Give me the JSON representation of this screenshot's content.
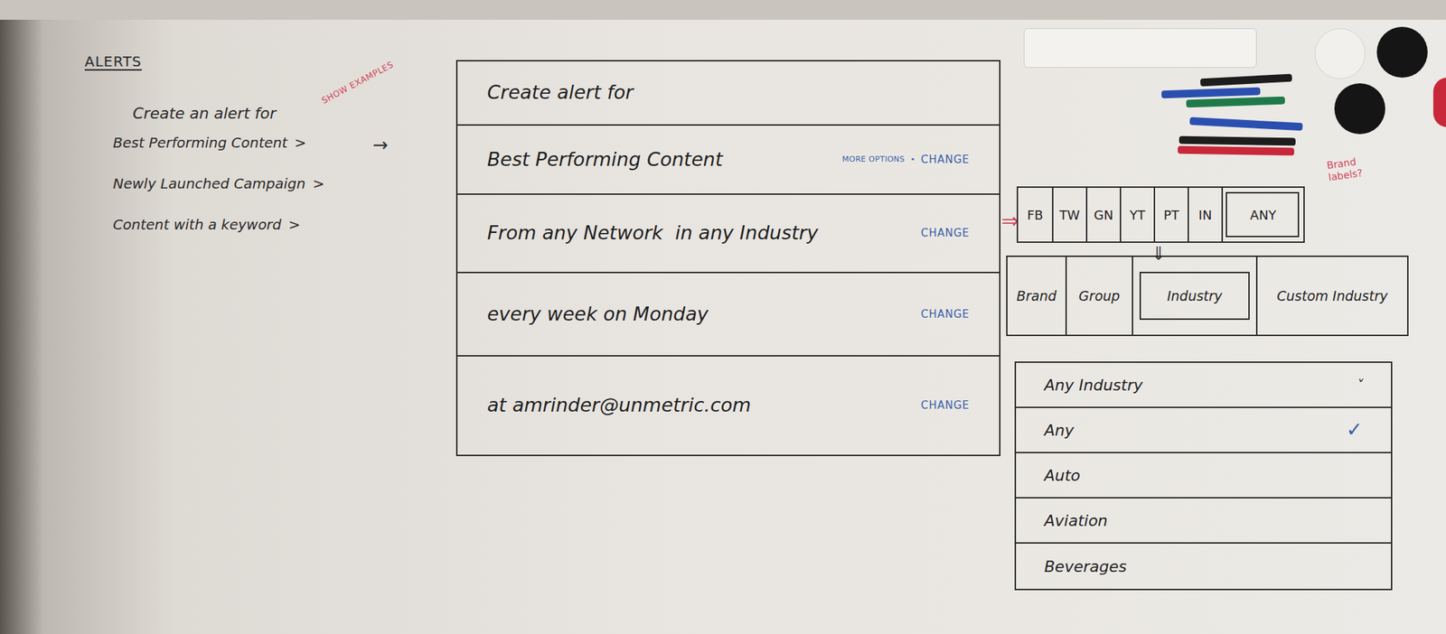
{
  "notes": {
    "title": "ALERTS",
    "intro": "Create an alert for",
    "annotation": "SHOW EXAMPLES",
    "arrow": "→",
    "items": [
      {
        "label": "Best Performing Content",
        "chevron": ">"
      },
      {
        "label": "Newly Launched Campaign",
        "chevron": ">"
      },
      {
        "label": "Content with a keyword",
        "chevron": ">"
      }
    ]
  },
  "card": {
    "rows": [
      {
        "text": "Create alert for",
        "actions": []
      },
      {
        "text": "Best Performing Content",
        "actions": [
          "MORE OPTIONS",
          "•",
          "CHANGE"
        ]
      },
      {
        "text": "From any Network  in any Industry",
        "actions": [
          "CHANGE"
        ]
      },
      {
        "text": "every week on Monday",
        "actions": [
          "CHANGE"
        ]
      },
      {
        "text": "at amrinder@unmetric.com",
        "actions": [
          "CHANGE"
        ]
      }
    ]
  },
  "arrows": {
    "right": "⇒",
    "down": "⇓"
  },
  "networks": {
    "annotation": "Brand labels?",
    "tabs": [
      {
        "label": "FB",
        "selected": false
      },
      {
        "label": "TW",
        "selected": false
      },
      {
        "label": "GN",
        "selected": false
      },
      {
        "label": "YT",
        "selected": false
      },
      {
        "label": "PT",
        "selected": false
      },
      {
        "label": "IN",
        "selected": false
      },
      {
        "label": "ANY",
        "selected": true
      }
    ]
  },
  "scope_tabs": [
    {
      "label": "Brand",
      "selected": false
    },
    {
      "label": "Group",
      "selected": false
    },
    {
      "label": "Industry",
      "selected": true
    },
    {
      "label": "Custom Industry",
      "selected": false
    }
  ],
  "dropdown": {
    "value": "Any Industry",
    "caret": "˅",
    "check": "✓",
    "options": [
      {
        "label": "Any",
        "selected": true
      },
      {
        "label": "Auto",
        "selected": false
      },
      {
        "label": "Aviation",
        "selected": false
      },
      {
        "label": "Beverages",
        "selected": false
      }
    ]
  }
}
